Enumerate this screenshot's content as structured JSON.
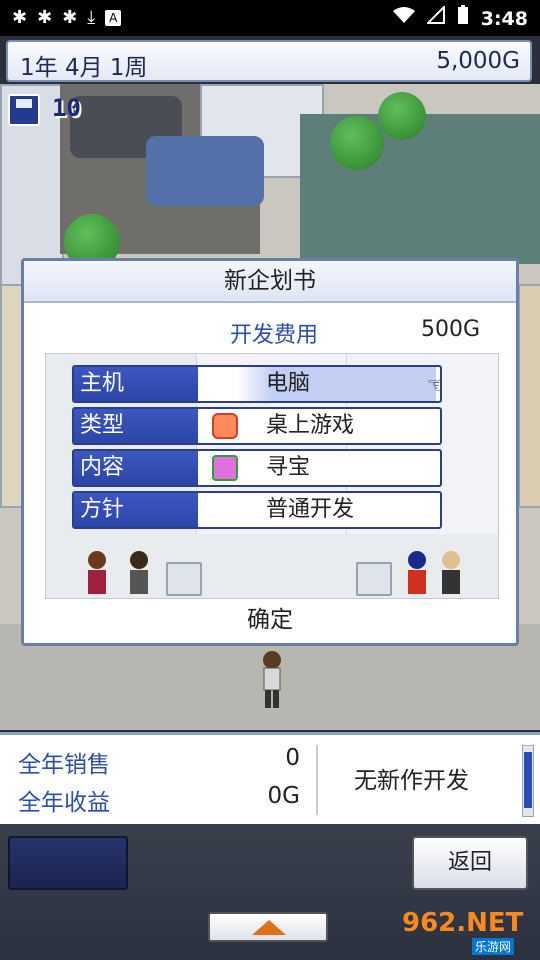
{
  "status_bar": {
    "left_icons": [
      "bug-icon",
      "bug-icon",
      "bug-icon",
      "download-icon",
      "font-icon"
    ],
    "right_icons": [
      "wifi-icon",
      "signal-icon",
      "battery-icon"
    ],
    "time": "3:48"
  },
  "top_bar": {
    "date": "1年 4月 1周",
    "money": "5,000G"
  },
  "scene": {
    "save_count": "10"
  },
  "dialog": {
    "title": "新企划书",
    "cost_label": "开发费用",
    "cost_value": "500G",
    "rows": [
      {
        "key": "主机",
        "value": "电脑"
      },
      {
        "key": "类型",
        "value": "桌上游戏"
      },
      {
        "key": "内容",
        "value": "寻宝"
      },
      {
        "key": "方针",
        "value": "普通开发"
      }
    ],
    "confirm": "确定"
  },
  "bottom_panel": {
    "annual_sales_label": "全年销售",
    "annual_sales_value": "0",
    "annual_revenue_label": "全年收益",
    "annual_revenue_value": "0G",
    "no_new_dev": "无新作开发"
  },
  "footer": {
    "back": "返回",
    "watermark": "962.NET",
    "watermark_sub": "乐游网"
  },
  "colors": {
    "accent_blue": "#2c45a8",
    "label_blue": "#2d4fa8",
    "expand_arrow": "#e0701a"
  }
}
